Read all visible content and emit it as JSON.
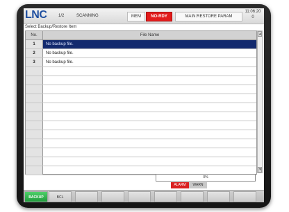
{
  "header": {
    "logo": "LNC",
    "page": "1/2",
    "mode": "SCANNING",
    "mem_label": "MEM",
    "status": "NO-RDY",
    "function": "MAIN:RESTORE PARAM",
    "time": "11:06:20",
    "time_sub": "0"
  },
  "subtitle": "Select Backup/Restore Item",
  "table": {
    "col_no": "No.",
    "col_name": "File Name",
    "rows": [
      {
        "no": "1",
        "name": "No backup file."
      },
      {
        "no": "2",
        "name": "No backup file."
      },
      {
        "no": "3",
        "name": "No backup file."
      },
      {
        "no": "",
        "name": ""
      },
      {
        "no": "",
        "name": ""
      },
      {
        "no": "",
        "name": ""
      },
      {
        "no": "",
        "name": ""
      },
      {
        "no": "",
        "name": ""
      },
      {
        "no": "",
        "name": ""
      },
      {
        "no": "",
        "name": ""
      },
      {
        "no": "",
        "name": ""
      },
      {
        "no": "",
        "name": ""
      },
      {
        "no": "",
        "name": ""
      },
      {
        "no": "",
        "name": ""
      },
      {
        "no": "",
        "name": ""
      }
    ],
    "selected_index": 0
  },
  "progress": {
    "text": "0%",
    "value": 0
  },
  "alarms": {
    "alarm": "ALARM",
    "warn": "WARN"
  },
  "softkeys": [
    {
      "label": "BACKUP"
    },
    {
      "label": "BCL"
    },
    {
      "label": ""
    },
    {
      "label": ""
    },
    {
      "label": ""
    },
    {
      "label": ""
    },
    {
      "label": ""
    },
    {
      "label": ""
    },
    {
      "label": ""
    }
  ],
  "colors": {
    "accent": "#1f4fa0",
    "status_red": "#e21b1b",
    "selection": "#132a6e",
    "back_green": "#1f9a3b"
  },
  "icons": {
    "scroll_up": "up-arrow-icon",
    "scroll_down": "down-arrow-icon"
  }
}
